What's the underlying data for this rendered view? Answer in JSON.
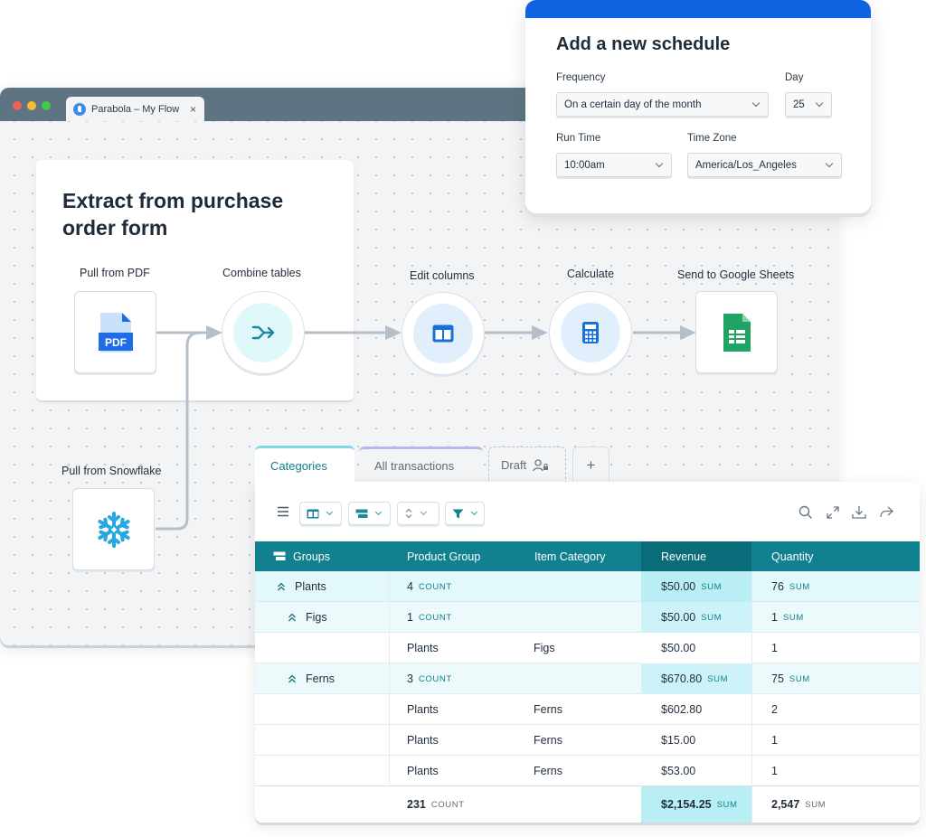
{
  "browser": {
    "tab_title": "Parabola – My Flow",
    "tab_close": "×"
  },
  "flow": {
    "title": "Extract from purchase order form",
    "steps": [
      {
        "label": "Pull from PDF",
        "icon": "pdf-file-icon"
      },
      {
        "label": "Combine tables",
        "icon": "combine-icon"
      },
      {
        "label": "Edit columns",
        "icon": "columns-icon"
      },
      {
        "label": "Calculate",
        "icon": "calculator-icon"
      },
      {
        "label": "Send to Google Sheets",
        "icon": "google-sheets-icon"
      },
      {
        "label": "Pull from Snowflake",
        "icon": "snowflake-icon"
      }
    ],
    "pdf_badge": "PDF"
  },
  "schedule": {
    "title": "Add a new schedule",
    "frequency_label": "Frequency",
    "frequency_value": "On a certain day of the month",
    "day_label": "Day",
    "day_value": "25",
    "run_time_label": "Run Time",
    "run_time_value": "10:00am",
    "time_zone_label": "Time Zone",
    "time_zone_value": "America/Los_Angeles"
  },
  "data_view": {
    "tabs": [
      {
        "label": "Categories",
        "active": true
      },
      {
        "label": "All transactions",
        "active": false
      },
      {
        "label": "Draft",
        "active": false
      },
      {
        "label": "+",
        "active": false
      }
    ],
    "columns": [
      "Groups",
      "Product Group",
      "Item Category",
      "Revenue",
      "Quantity"
    ],
    "rows": [
      {
        "group": "Plants",
        "c1": "4",
        "c1_agg": "COUNT",
        "c2": "",
        "rev": "$50.00",
        "rev_agg": "SUM",
        "qty": "76",
        "qty_agg": "SUM"
      },
      {
        "group": "Figs",
        "c1": "1",
        "c1_agg": "COUNT",
        "c2": "",
        "rev": "$50.00",
        "rev_agg": "SUM",
        "qty": "1",
        "qty_agg": "SUM"
      },
      {
        "group": "",
        "c1": "Plants",
        "c1_agg": "",
        "c2": "Figs",
        "rev": "$50.00",
        "rev_agg": "",
        "qty": "1",
        "qty_agg": ""
      },
      {
        "group": "Ferns",
        "c1": "3",
        "c1_agg": "COUNT",
        "c2": "",
        "rev": "$670.80",
        "rev_agg": "SUM",
        "qty": "75",
        "qty_agg": "SUM"
      },
      {
        "group": "",
        "c1": "Plants",
        "c1_agg": "",
        "c2": "Ferns",
        "rev": "$602.80",
        "rev_agg": "",
        "qty": "2",
        "qty_agg": ""
      },
      {
        "group": "",
        "c1": "Plants",
        "c1_agg": "",
        "c2": "Ferns",
        "rev": "$15.00",
        "rev_agg": "",
        "qty": "1",
        "qty_agg": ""
      },
      {
        "group": "",
        "c1": "Plants",
        "c1_agg": "",
        "c2": "Ferns",
        "rev": "$53.00",
        "rev_agg": "",
        "qty": "1",
        "qty_agg": ""
      }
    ],
    "footer": {
      "c1": "231",
      "c1_agg": "COUNT",
      "rev": "$2,154.25",
      "rev_agg": "SUM",
      "qty": "2,547",
      "qty_agg": "SUM"
    }
  },
  "colors": {
    "accent_blue": "#0f63e0",
    "header_teal": "#11808f",
    "revenue_highlight": "#b9eef5",
    "group_row_bg": "#e3f8fb"
  }
}
